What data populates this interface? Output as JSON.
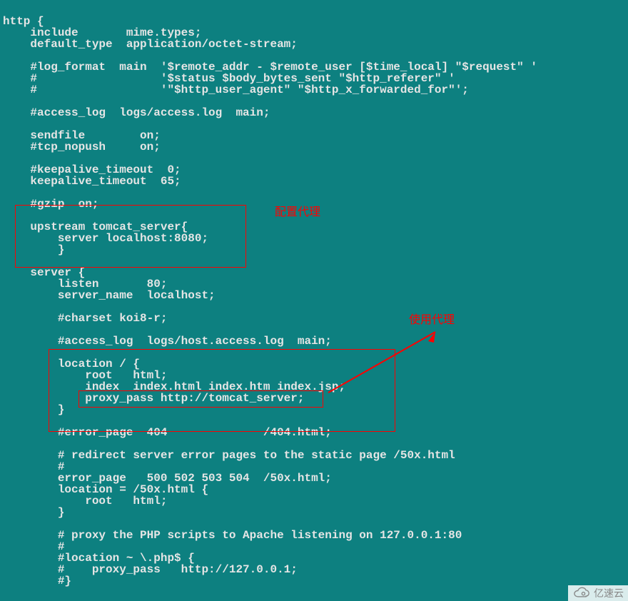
{
  "config_lines": [
    "",
    "http {",
    "    include       mime.types;",
    "    default_type  application/octet-stream;",
    "",
    "    #log_format  main  '$remote_addr - $remote_user [$time_local] \"$request\" '",
    "    #                  '$status $body_bytes_sent \"$http_referer\" '",
    "    #                  '\"$http_user_agent\" \"$http_x_forwarded_for\"';",
    "",
    "    #access_log  logs/access.log  main;",
    "",
    "    sendfile        on;",
    "    #tcp_nopush     on;",
    "",
    "    #keepalive_timeout  0;",
    "    keepalive_timeout  65;",
    "",
    "    #gzip  on;",
    "",
    "    upstream tomcat_server{",
    "        server localhost:8080;",
    "        }",
    "",
    "    server {",
    "        listen       80;",
    "        server_name  localhost;",
    "",
    "        #charset koi8-r;",
    "",
    "        #access_log  logs/host.access.log  main;",
    "",
    "        location / {",
    "            root   html;",
    "            index  index.html index.htm index.jsp;",
    "            proxy_pass http://tomcat_server;",
    "        }",
    "",
    "        #error_page  404              /404.html;",
    "",
    "        # redirect server error pages to the static page /50x.html",
    "        #",
    "        error_page   500 502 503 504  /50x.html;",
    "        location = /50x.html {",
    "            root   html;",
    "        }",
    "",
    "        # proxy the PHP scripts to Apache listening on 127.0.0.1:80",
    "        #",
    "        #location ~ \\.php$ {",
    "        #    proxy_pass   http://127.0.0.1;",
    "        #}",
    ""
  ],
  "annotations": {
    "config_proxy": "配置代理",
    "use_proxy": "使用代理"
  },
  "watermark": "亿速云"
}
